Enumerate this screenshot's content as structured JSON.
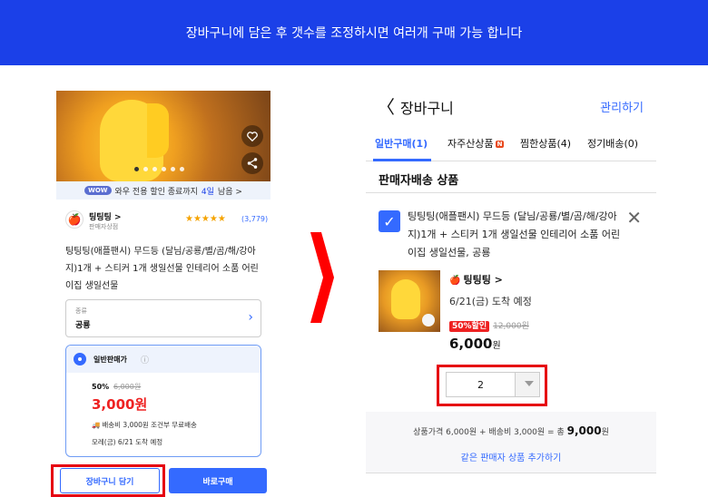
{
  "banner": {
    "text": "장바구니에 담은 후 갯수를 조정하시면 여러개 구매 가능 합니다"
  },
  "left": {
    "wow_badge": "WOW",
    "wow_text": "와우 전용 할인 종료까지",
    "wow_days": "4일",
    "wow_suffix": "남음 >",
    "seller_name": "팅팅팅 >",
    "seller_sub": "판매자상점",
    "stars": "★★★★★",
    "rating_count": "(3,779)",
    "product_title": "팅팅팅(애플팬시) 무드등 (달님/공룡/별/곰/해/강아지)1개 + 스티커 1개 생일선물 인테리어 소품 어린이집 생일선물",
    "option_label": "종류",
    "option_value": "공룡",
    "price_type": "일반판매가",
    "discount_rate": "50%",
    "original_price": "6,000원",
    "sale_price": "3,000원",
    "shipping": "배송비 3,000원 조건부 무료배송",
    "arrival": "모레(금) 6/21 도착 예정",
    "cart_button": "장바구니 담기",
    "buy_button": "바로구매"
  },
  "right": {
    "header_title": "장바구니",
    "manage": "관리하기",
    "tabs": [
      {
        "label": "일반구매(1)"
      },
      {
        "label": "자주산상품",
        "badge": "N"
      },
      {
        "label": "찜한상품(4)"
      },
      {
        "label": "정기배송(0)"
      }
    ],
    "section_title": "판매자배송 상품",
    "product_title": "팅팅팅(애플팬시) 무드등 (달님/공룡/별/곰/해/강아지)1개 + 스티커 1개 생일선물 인테리어 소품 어린이집 생일선물, 공룡",
    "seller": "팅팅팅 >",
    "delivery": "6/21(금) 도착 예정",
    "discount_badge": "50%할인",
    "original_price": "12,000원",
    "price": "6,000",
    "price_unit": "원",
    "quantity": "2",
    "summary_prefix": "상품가격  6,000원 + 배송비  3,000원 = 총",
    "summary_total": "9,000",
    "summary_unit": "원",
    "add_more": "같은 판매자 상품 추가하기"
  },
  "colors": {
    "banner": "#1b40e8",
    "accent": "#346aff",
    "highlight": "#e60012",
    "sale": "#e22222"
  }
}
